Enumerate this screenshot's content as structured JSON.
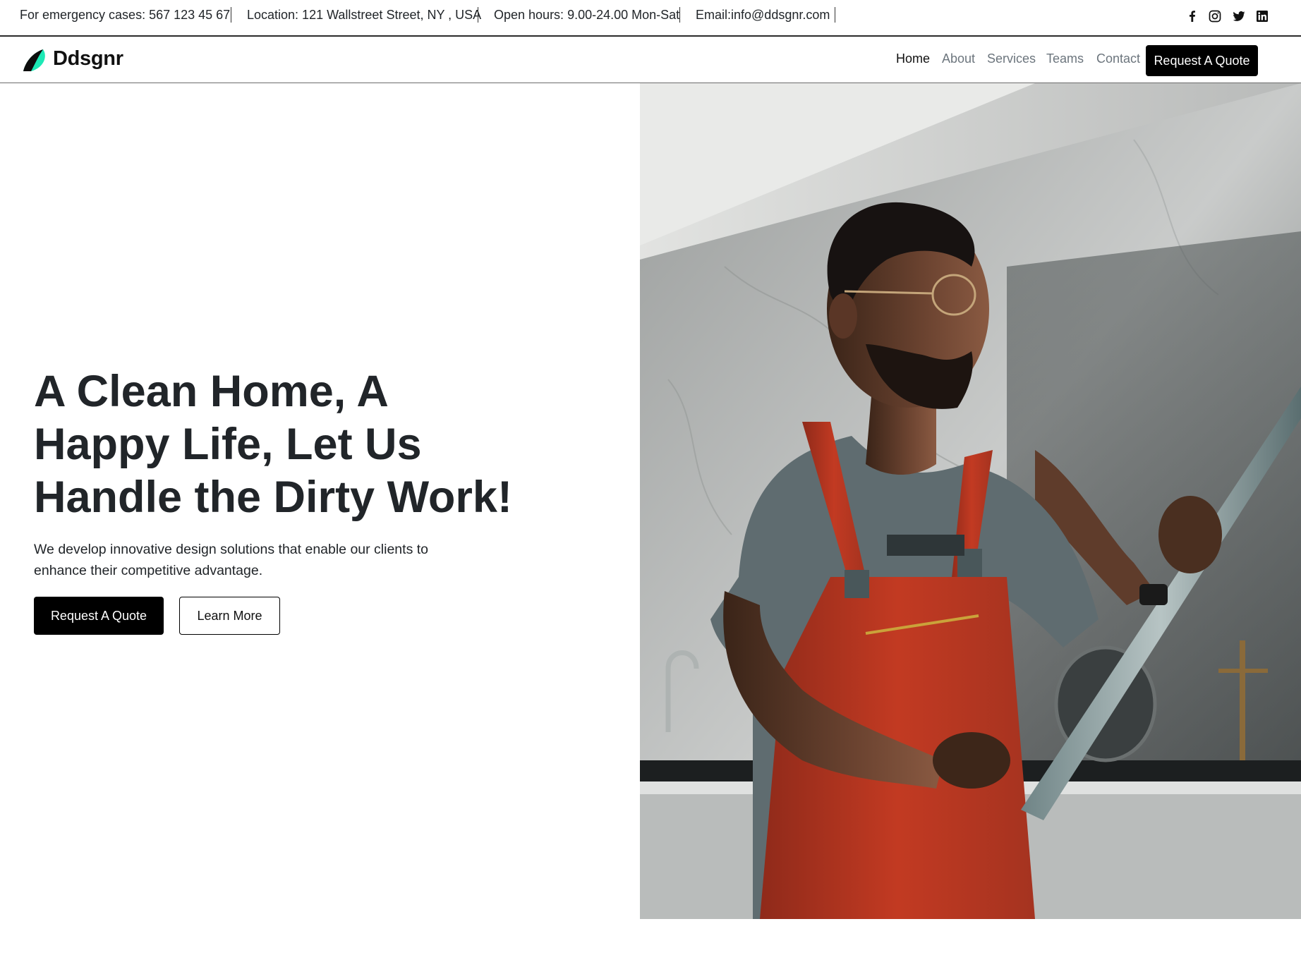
{
  "topbar": {
    "emergency": "For emergency cases: 567 123 45 67",
    "location": "Location: 121 Wallstreet Street, NY , USA",
    "hours": "Open hours: 9.00-24.00 Mon-Sat",
    "email": "Email:info@ddsgnr.com",
    "social_icons": [
      "facebook-icon",
      "instagram-icon",
      "twitter-icon",
      "linkedin-icon"
    ]
  },
  "brand": {
    "name": "Ddsgnr",
    "accent": "#1de9b6"
  },
  "nav": {
    "items": [
      "Home",
      "About",
      "Services",
      "Teams",
      "Contact"
    ],
    "active": "Home",
    "cta": "Request A Quote"
  },
  "hero": {
    "title_lines": [
      "A Clean Home, A",
      "Happy Life, Let Us",
      "Handle the Dirty Work!"
    ],
    "subtitle": "We develop innovative design solutions that enable our clients to enhance their competitive advantage.",
    "primary_button": "Request A Quote",
    "secondary_button": "Learn More"
  },
  "colors": {
    "text": "#212529",
    "muted": "#6c757d",
    "button": "#000000",
    "overalls": "#c23a22"
  }
}
